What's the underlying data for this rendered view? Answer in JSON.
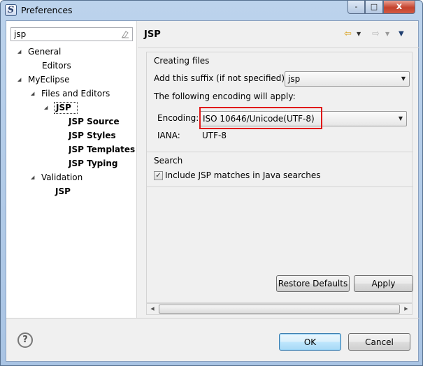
{
  "window": {
    "title": "Preferences",
    "close_glyph": "x",
    "minimize_glyph": "-",
    "maximize_glyph": "□",
    "app_icon_glyph": "S"
  },
  "filter": {
    "value": "jsp",
    "clear_icon": "eraser-icon"
  },
  "tree": {
    "general": "General",
    "editors": "Editors",
    "myeclipse": "MyEclipse",
    "files_and_editors": "Files and Editors",
    "jsp": "JSP",
    "jsp_source": "JSP Source",
    "jsp_styles": "JSP Styles",
    "jsp_templates": "JSP Templates",
    "jsp_typing": "JSP Typing",
    "validation": "Validation",
    "validation_jsp": "JSP"
  },
  "page": {
    "title": "JSP",
    "creating_files": {
      "heading": "Creating files",
      "suffix_label": "Add this suffix (if not specified):",
      "suffix_value": "jsp",
      "encoding_note": "The following encoding will apply:",
      "encoding_label": "Encoding:",
      "encoding_value": "ISO 10646/Unicode(UTF-8)",
      "iana_label": "IANA:",
      "iana_value": "UTF-8"
    },
    "search": {
      "heading": "Search",
      "include_label": "Include JSP matches in Java searches",
      "include_checked": true
    }
  },
  "buttons": {
    "restore_defaults": "Restore Defaults",
    "apply": "Apply",
    "ok": "OK",
    "cancel": "Cancel"
  },
  "colors": {
    "highlight": "#e01818",
    "title_bar": "#bcd3ec"
  }
}
